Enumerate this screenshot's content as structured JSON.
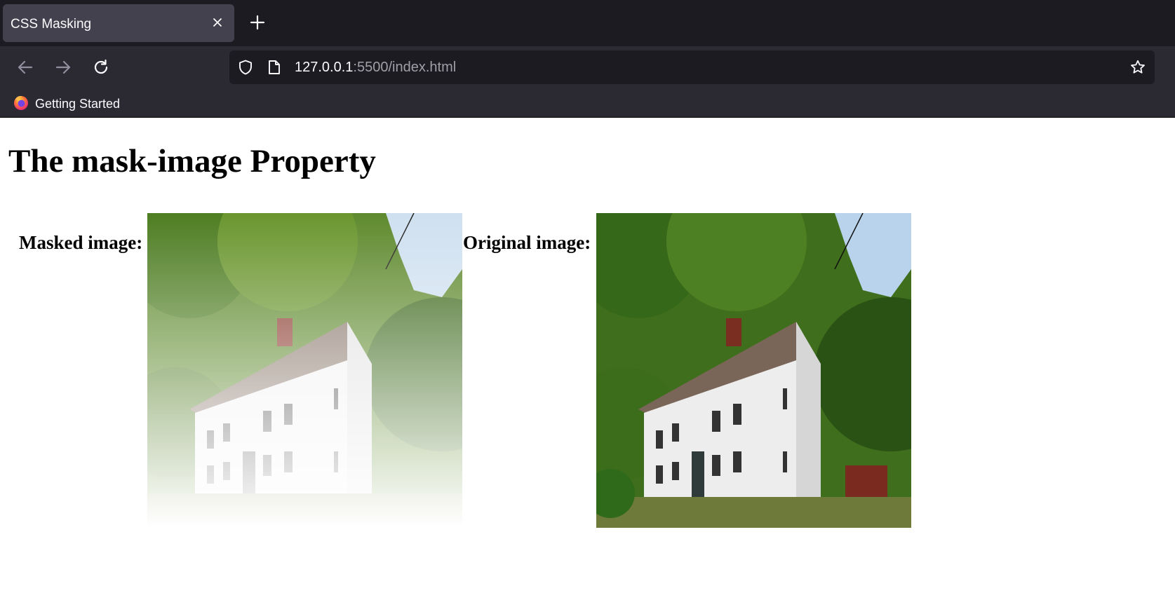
{
  "browser": {
    "tab_title": "CSS Masking",
    "url_host": "127.0.0.1",
    "url_rest": ":5500/index.html",
    "bookmark_label": "Getting Started",
    "icons": {
      "tab_close": "close-icon",
      "new_tab": "plus-icon",
      "back": "arrow-left-icon",
      "forward": "arrow-right-icon",
      "reload": "reload-icon",
      "security": "shield-icon",
      "page": "document-icon",
      "bookmark_star": "star-icon",
      "bookmark_favicon": "firefox-icon"
    }
  },
  "page": {
    "heading": "The mask-image Property",
    "masked_label": "Masked image:",
    "original_label": "Original image:"
  },
  "colors": {
    "chrome_dark": "#1c1b22",
    "chrome_mid": "#2b2a33",
    "tab_active": "#42414d",
    "chrome_text": "#fbfbfe",
    "url_dim": "#a09fa6"
  }
}
